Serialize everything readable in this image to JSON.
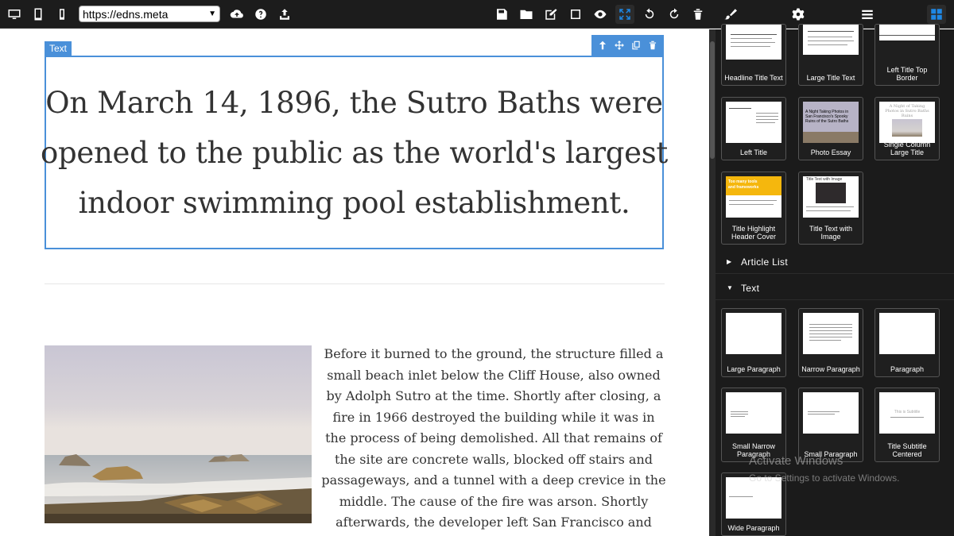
{
  "toolbar": {
    "url": "https://edns.meta",
    "icons": [
      "desktop-icon",
      "tablet-icon",
      "mobile-icon",
      "upload-cloud-icon",
      "help-icon",
      "export-icon",
      "save-icon",
      "folder-icon",
      "edit-icon",
      "square-icon",
      "eye-icon",
      "fullscreen-icon",
      "undo-icon",
      "redo-icon",
      "trash-icon",
      "brush-icon",
      "gear-icon",
      "menu-icon",
      "blocks-icon"
    ],
    "accent": "#1e88e5"
  },
  "canvas": {
    "selected_block_tag": "Text",
    "headline": "On March 14, 1896, the Sutro Baths were opened to the public as the world's largest indoor swimming pool establishment.",
    "headline_lines": [
      "On March 14, 1896, the Sutro Baths were",
      "opened to the public as the world's largest",
      "indoor swimming pool establishment."
    ],
    "body_paragraph": "Before it burned to the ground, the structure filled a small beach inlet below the Cliff House, also owned by Adolph Sutro at the time. Shortly after closing, a fire in 1966 destroyed the building while it was in the process of being demolished. All that remains of the site are concrete walls, blocked off stairs and passageways, and a tunnel with a deep crevice in the middle. The cause of the fire was arson. Shortly afterwards, the developer left San Francisco and claimed insurance money.",
    "selection_color": "#4a90d9"
  },
  "sidebar": {
    "title_cards": [
      {
        "label": "Headline Title Text"
      },
      {
        "label": "Large Title Text"
      },
      {
        "label": "Left Title Top Border"
      },
      {
        "label": "Left Title"
      },
      {
        "label": "Photo Essay"
      },
      {
        "label": "Single Column Large Title"
      },
      {
        "label": "Title Highlight Header Cover"
      },
      {
        "label": "Title Text with Image"
      }
    ],
    "sections": [
      {
        "label": "Article List",
        "expanded": false
      },
      {
        "label": "Text",
        "expanded": true
      }
    ],
    "text_cards": [
      {
        "label": "Large Paragraph"
      },
      {
        "label": "Narrow Paragraph"
      },
      {
        "label": "Paragraph"
      },
      {
        "label": "Small Narrow Paragraph"
      },
      {
        "label": "Small Paragraph"
      },
      {
        "label": "Title Subtitle Centered"
      },
      {
        "label": "Wide Paragraph"
      }
    ],
    "thumb_texts": {
      "photo_essay": "A Night Taking Photos in San Francisco's Spooky Ruins of the Sutro Baths",
      "single_column": "A Night of Taking Photos in Sutro Baths Ruins",
      "highlight": "Too many tools and frameworks",
      "title_text_image": "Title Text with Image",
      "subtitle": "This is Subtitle"
    }
  },
  "os_watermark": {
    "line1": "Activate Windows",
    "line2": "Go to Settings to activate Windows."
  }
}
